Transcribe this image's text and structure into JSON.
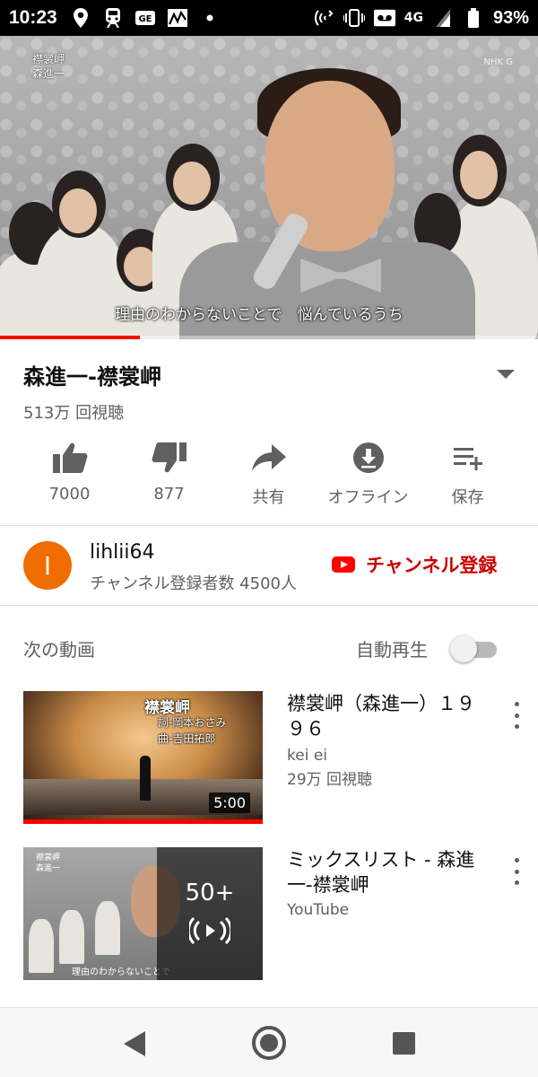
{
  "status": {
    "time": "10:23",
    "network": "4G",
    "battery": "93%"
  },
  "player": {
    "overlay_title": "襟裳岬",
    "overlay_artist": "森進一",
    "overlay_logo": "NHK G",
    "subtitle": "理由のわからないことで　悩んでいるうち",
    "progress": 0.26
  },
  "video": {
    "title": "森進一-襟裳岬",
    "views": "513万 回視聴"
  },
  "actions": [
    {
      "label": "7000",
      "icon": "thumbs-up-icon"
    },
    {
      "label": "877",
      "icon": "thumbs-down-icon"
    },
    {
      "label": "共有",
      "icon": "share-icon"
    },
    {
      "label": "オフライン",
      "icon": "download-icon"
    },
    {
      "label": "保存",
      "icon": "playlist-add-icon"
    }
  ],
  "channel": {
    "avatar_letter": "I",
    "avatar_color": "#ef6c00",
    "name": "lihlii64",
    "subscribers": "チャンネル登録者数 4500人",
    "subscribe_label": "チャンネル登録"
  },
  "upnext": {
    "heading": "次の動画",
    "autoplay_label": "自動再生",
    "autoplay_on": false
  },
  "items": [
    {
      "title": "襟裳岬（森進一）１９９６",
      "channel": "kei ei",
      "views": "29万 回視聴",
      "duration": "5:00",
      "thumb_caption": "襟裳岬",
      "thumb_caption2": "詞-岡本おさみ",
      "thumb_caption3": "曲-吉田拓郎"
    },
    {
      "title": "ミックスリスト - 森進一-襟裳岬",
      "channel": "YouTube",
      "count": "50+",
      "thumb_caption": "襟裳岬",
      "thumb_caption2": "森進一",
      "thumb_sub": "理由のわからないことで"
    }
  ]
}
